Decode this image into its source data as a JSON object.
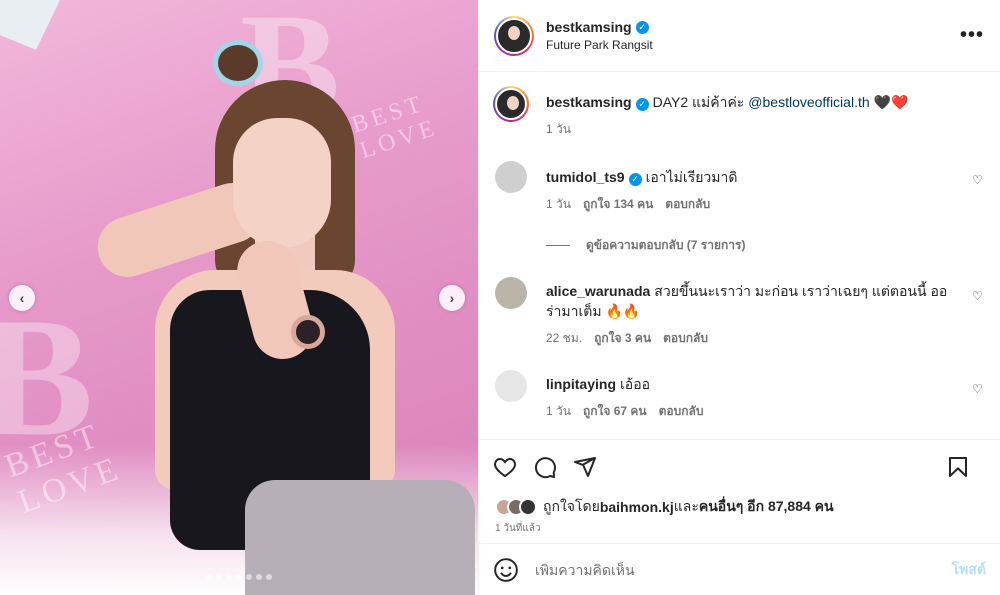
{
  "media": {
    "prev_icon": "chevron-left-icon",
    "next_icon": "chevron-right-icon",
    "carousel_total": 7,
    "carousel_active": 4
  },
  "post": {
    "username": "bestkamsing",
    "location": "Future Park Rangsit",
    "more_icon": "more-horizontal-icon",
    "caption": {
      "username": "bestkamsing",
      "text": "DAY2 แม่ค้าค่ะ ",
      "mention": "@bestloveofficial.th",
      "emoji": " 🖤❤️",
      "time": "1 วัน"
    }
  },
  "comments": [
    {
      "username": "tumidol_ts9",
      "verified": true,
      "text": "เอาไม่เรียวมาดิ",
      "time": "1 วัน",
      "likes": "ถูกใจ 134 คน",
      "reply": "ตอบกลับ",
      "view_replies": "ดูข้อความตอบกลับ (7 รายการ)"
    },
    {
      "username": "alice_warunada",
      "verified": false,
      "text": "สวยขึ้นนะเราว่า มะก่อน เราว่าเฉยๆ แต่ตอนนี้ ออร่ามาเต็ม 🔥🔥",
      "time": "22 ชม.",
      "likes": "ถูกใจ 3 คน",
      "reply": "ตอบกลับ"
    },
    {
      "username": "linpitaying",
      "verified": false,
      "text": "เอ้ออ",
      "time": "1 วัน",
      "likes": "ถูกใจ 67 คน",
      "reply": "ตอบกลับ"
    }
  ],
  "actions": {
    "like_icon": "heart-icon",
    "comment_icon": "comment-icon",
    "share_icon": "send-icon",
    "save_icon": "bookmark-icon"
  },
  "likes": {
    "prefix": "ถูกใจโดย ",
    "user": "baihmon.kj",
    "suffix": " และ",
    "others": "คนอื่นๆ อีก 87,884 คน"
  },
  "date": "1 วันที่แล้ว",
  "add_comment": {
    "placeholder": "เพิ่มความคิดเห็น",
    "post_label": "โพสต์"
  },
  "colors": {
    "accent": "#0095f6",
    "mention": "#00376b",
    "post_disabled": "#b2dffc"
  }
}
